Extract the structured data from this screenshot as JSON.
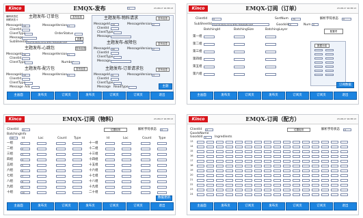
{
  "brand": "Kinco",
  "datetime": "23-08-17 16:38:13",
  "nav": [
    "主画面",
    "发布页",
    "订阅页",
    "发布页",
    "订阅页",
    "订阅页",
    "退出"
  ],
  "p1": {
    "title": "EMQX-发布",
    "page_box": "1",
    "corner_top": "编码状态位",
    "corner_mid": "网联状态 0",
    "sections": {
      "order": "主题发布-订单包",
      "material": "主题发布-物料请求",
      "heartbeat": "主题发布-心跳包",
      "alarm": "主题发布-故障包",
      "recipe": "主题发布-配方包",
      "reply": "主题发布-订单请求包"
    },
    "labels": {
      "messageid": "MessageId",
      "messageversion": "MessageVersion",
      "clientid": "ClientId",
      "clienttype": "ClientType",
      "message": "Message",
      "orderstatus": "OrderStatus",
      "subsheetid": "SubSheetId",
      "number": "Number",
      "readtype": "ReadType",
      "ads": "Ads"
    },
    "button_publish": "发布信息",
    "button_view": "查看",
    "button_confirm": "主题",
    "guid": "f1a7c9-0b2e-4c1a-9f3d-7b6a0e8c1d2f",
    "vals": {
      "id1": "10",
      "ver1": "2",
      "id2": "10",
      "ver2": "2",
      "id3": "30",
      "ver3": "1",
      "id4": "60",
      "ver4": "2",
      "id5": "10",
      "ver5": "2",
      "id6": "0",
      "ver6": "3"
    }
  },
  "p2": {
    "title": "EMQX-订阅（订单）",
    "client_label": "ClientId",
    "client_val": "0",
    "sortnum_label": "SortNum",
    "sortnum_val": "73",
    "parse_label": "解析字符状态",
    "parse_val": "0",
    "subsheet_label": "SubSheetId",
    "subsheet_val": "f1a7c9-0b2e-4c1a-9f3d-7b6a0e8c1d2f",
    "goodid_label": "GoodsId",
    "goodid_val": "0",
    "num_label": "Num",
    "num_val": "0",
    "setting_btn": "配置项",
    "batch_label": "BatchingId",
    "batchsize_label": "BatchingSize",
    "batchlayer_label": "BatchingLayer",
    "rows": [
      "第一组",
      "第二组",
      "第三组",
      "第四组",
      "第五组",
      "第六组"
    ],
    "group_btn": "数据分组",
    "ok_btn": "订阅数据"
  },
  "p3": {
    "title": "EMQX-订阅（物料）",
    "client_label": "ClientId",
    "client_val": "0",
    "batch_label": "BatchingInfo",
    "batch_val": "10",
    "loc_btn": "位置检测",
    "parse_label": "解析字符状态",
    "parse_val": "0",
    "cols_left": [
      "Id",
      "Loc",
      "Count",
      "Type"
    ],
    "cols_right": [
      "Id",
      "Loc",
      "Count",
      "Type"
    ],
    "rows_left": [
      "一组",
      "二组",
      "三组",
      "四组",
      "五组",
      "六组",
      "七组",
      "八组",
      "九组",
      "十组"
    ],
    "rows_right": [
      "十一组",
      "十二组",
      "十三组",
      "十四组",
      "十五组",
      "十六组",
      "十七组",
      "十八组",
      "十九组",
      "二十组"
    ],
    "left_ids": [
      "1",
      "2",
      "3",
      "4",
      "5",
      "6",
      "7",
      "8",
      "9",
      "10"
    ],
    "refresh_btn": "数据更新"
  },
  "p4": {
    "title": "EMQX-订阅（配方）",
    "client_label": "ClientId",
    "client_val": "0",
    "good_label": "GoodsName",
    "goodid_label": "GoodsId",
    "goodid_val": "0",
    "ingredients_label": "IngredIents",
    "loc_btn": "位置检测",
    "parse_label": "解析字符状态",
    "parse_val": "0",
    "row_labels": [
      "13",
      "14",
      "15",
      "16",
      "17",
      "18",
      "19",
      "20",
      "21",
      "22",
      "23",
      "24"
    ]
  }
}
